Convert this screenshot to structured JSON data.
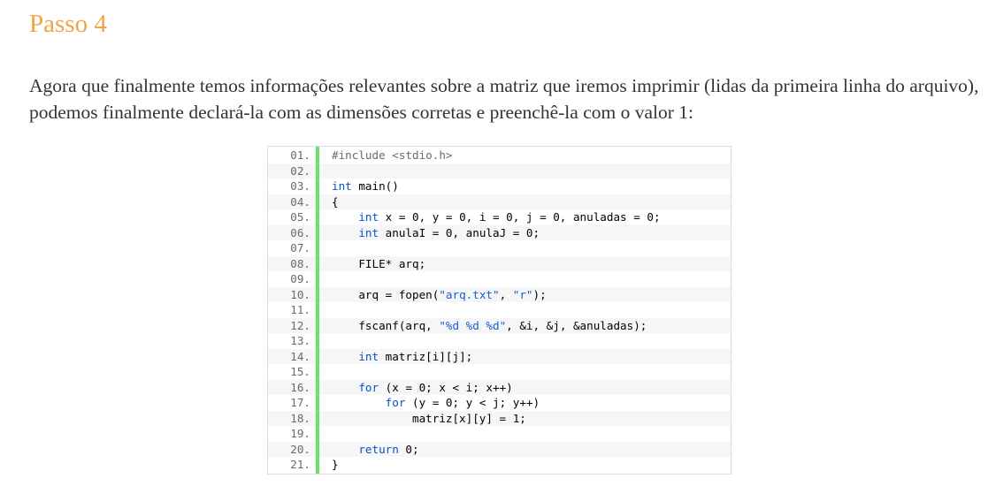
{
  "heading": "Passo 4",
  "paragraph": "Agora que finalmente temos informações relevantes sobre a matriz que iremos imprimir (lidas da primeira linha do arquivo), podemos finalmente declará-la com as dimensões corretas e preenchê-la com o valor 1:",
  "colors": {
    "heading": "#f0a448",
    "gutter_bar": "#6ce26c",
    "keyword": "#0b50c7",
    "string": "#1a5bd6"
  },
  "code": [
    {
      "num": "01.",
      "segs": [
        [
          "pp",
          "#include <stdio.h>"
        ]
      ]
    },
    {
      "num": "02.",
      "segs": []
    },
    {
      "num": "03.",
      "segs": [
        [
          "kw",
          "int"
        ],
        [
          "",
          " main()"
        ]
      ]
    },
    {
      "num": "04.",
      "segs": [
        [
          "",
          "{"
        ]
      ]
    },
    {
      "num": "05.",
      "segs": [
        [
          "",
          "    "
        ],
        [
          "kw",
          "int"
        ],
        [
          "",
          " x = 0, y = 0, i = 0, j = 0, anuladas = 0;"
        ]
      ]
    },
    {
      "num": "06.",
      "segs": [
        [
          "",
          "    "
        ],
        [
          "kw",
          "int"
        ],
        [
          "",
          " anulaI = 0, anulaJ = 0;"
        ]
      ]
    },
    {
      "num": "07.",
      "segs": []
    },
    {
      "num": "08.",
      "segs": [
        [
          "",
          "    FILE* arq;"
        ]
      ]
    },
    {
      "num": "09.",
      "segs": []
    },
    {
      "num": "10.",
      "segs": [
        [
          "",
          "    arq = fopen("
        ],
        [
          "str",
          "\"arq.txt\""
        ],
        [
          "",
          ", "
        ],
        [
          "str",
          "\"r\""
        ],
        [
          "",
          ");"
        ]
      ]
    },
    {
      "num": "11.",
      "segs": []
    },
    {
      "num": "12.",
      "segs": [
        [
          "",
          "    fscanf(arq, "
        ],
        [
          "str",
          "\"%d %d %d\""
        ],
        [
          "",
          ", &i, &j, &anuladas);"
        ]
      ]
    },
    {
      "num": "13.",
      "segs": []
    },
    {
      "num": "14.",
      "segs": [
        [
          "",
          "    "
        ],
        [
          "kw",
          "int"
        ],
        [
          "",
          " matriz[i][j];"
        ]
      ]
    },
    {
      "num": "15.",
      "segs": []
    },
    {
      "num": "16.",
      "segs": [
        [
          "",
          "    "
        ],
        [
          "kw",
          "for"
        ],
        [
          "",
          " (x = 0; x < i; x++)"
        ]
      ]
    },
    {
      "num": "17.",
      "segs": [
        [
          "",
          "        "
        ],
        [
          "kw",
          "for"
        ],
        [
          "",
          " (y = 0; y < j; y++)"
        ]
      ]
    },
    {
      "num": "18.",
      "segs": [
        [
          "",
          "            matriz[x][y] = 1;"
        ]
      ]
    },
    {
      "num": "19.",
      "segs": []
    },
    {
      "num": "20.",
      "segs": [
        [
          "",
          "    "
        ],
        [
          "kw",
          "return"
        ],
        [
          "",
          " 0;"
        ]
      ]
    },
    {
      "num": "21.",
      "segs": [
        [
          "",
          "}"
        ]
      ]
    }
  ]
}
